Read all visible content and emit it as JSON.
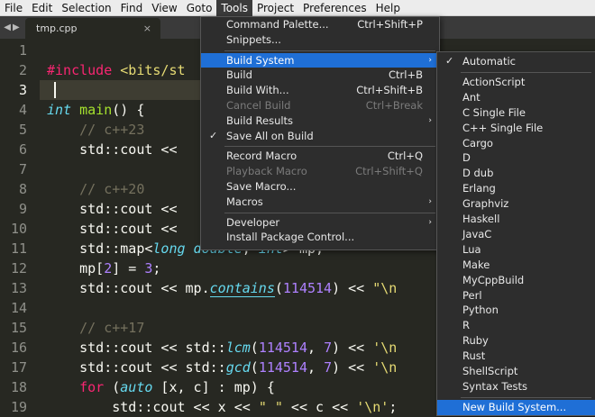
{
  "menubar": [
    "File",
    "Edit",
    "Selection",
    "Find",
    "View",
    "Goto",
    "Tools",
    "Project",
    "Preferences",
    "Help"
  ],
  "menubar_active": "Tools",
  "tabs": {
    "nav_arrows": "◀▶",
    "current": "tmp.cpp",
    "close_glyph": "×"
  },
  "editor": {
    "line_numbers": [
      "1",
      "2",
      "3",
      "4",
      "5",
      "6",
      "7",
      "8",
      "9",
      "10",
      "11",
      "12",
      "13",
      "14",
      "15",
      "16",
      "17",
      "18",
      "19"
    ],
    "current_line": "3",
    "lines": [
      [],
      [
        {
          "t": "#include ",
          "c": "pp"
        },
        {
          "t": "<bits/st",
          "c": "st"
        }
      ],
      [],
      [
        {
          "t": "int",
          "c": "tp"
        },
        {
          "t": " "
        },
        {
          "t": "main",
          "c": "fn"
        },
        {
          "t": "() {"
        }
      ],
      [
        {
          "t": "    "
        },
        {
          "t": "// c++23",
          "c": "cm"
        }
      ],
      [
        {
          "t": "    std::cout << "
        }
      ],
      [],
      [
        {
          "t": "    "
        },
        {
          "t": "// c++20",
          "c": "cm"
        }
      ],
      [
        {
          "t": "    std::cout << "
        }
      ],
      [
        {
          "t": "    std::cout << "
        }
      ],
      [
        {
          "t": "    std::map<"
        },
        {
          "t": "long double",
          "c": "tp"
        },
        {
          "t": ", "
        },
        {
          "t": "int",
          "c": "tp"
        },
        {
          "t": "> mp;"
        }
      ],
      [
        {
          "t": "    mp["
        },
        {
          "t": "2",
          "c": "nm"
        },
        {
          "t": "] = "
        },
        {
          "t": "3",
          "c": "nm"
        },
        {
          "t": ";"
        }
      ],
      [
        {
          "t": "    std::cout << mp."
        },
        {
          "t": "contains",
          "c": "tp ul"
        },
        {
          "t": "("
        },
        {
          "t": "114514",
          "c": "nm"
        },
        {
          "t": ") << "
        },
        {
          "t": "\"\\n",
          "c": "st"
        }
      ],
      [],
      [
        {
          "t": "    "
        },
        {
          "t": "// c++17",
          "c": "cm"
        }
      ],
      [
        {
          "t": "    std::cout << std::"
        },
        {
          "t": "lcm",
          "c": "tp"
        },
        {
          "t": "("
        },
        {
          "t": "114514",
          "c": "nm"
        },
        {
          "t": ", "
        },
        {
          "t": "7",
          "c": "nm"
        },
        {
          "t": ") << "
        },
        {
          "t": "'\\n",
          "c": "st"
        }
      ],
      [
        {
          "t": "    std::cout << std::"
        },
        {
          "t": "gcd",
          "c": "tp"
        },
        {
          "t": "("
        },
        {
          "t": "114514",
          "c": "nm"
        },
        {
          "t": ", "
        },
        {
          "t": "7",
          "c": "nm"
        },
        {
          "t": ") << "
        },
        {
          "t": "'\\n",
          "c": "st"
        }
      ],
      [
        {
          "t": "    "
        },
        {
          "t": "for",
          "c": "kw"
        },
        {
          "t": " ("
        },
        {
          "t": "auto",
          "c": "tp"
        },
        {
          "t": " [x, c] : mp) {"
        }
      ],
      [
        {
          "t": "        std::cout << x << "
        },
        {
          "t": "\" \"",
          "c": "st"
        },
        {
          "t": " << c << "
        },
        {
          "t": "'\\n'",
          "c": "st"
        },
        {
          "t": ";"
        }
      ]
    ]
  },
  "tools_menu": [
    {
      "label": "Command Palette...",
      "shortcut": "Ctrl+Shift+P"
    },
    {
      "label": "Snippets..."
    },
    {
      "sep": true
    },
    {
      "label": "Build System",
      "submenu": true,
      "highlighted": true
    },
    {
      "label": "Build",
      "shortcut": "Ctrl+B"
    },
    {
      "label": "Build With...",
      "shortcut": "Ctrl+Shift+B"
    },
    {
      "label": "Cancel Build",
      "shortcut": "Ctrl+Break",
      "disabled": true
    },
    {
      "label": "Build Results",
      "submenu": true
    },
    {
      "label": "Save All on Build",
      "checked": true
    },
    {
      "sep": true
    },
    {
      "label": "Record Macro",
      "shortcut": "Ctrl+Q"
    },
    {
      "label": "Playback Macro",
      "shortcut": "Ctrl+Shift+Q",
      "disabled": true
    },
    {
      "label": "Save Macro..."
    },
    {
      "label": "Macros",
      "submenu": true
    },
    {
      "sep": true
    },
    {
      "label": "Developer",
      "submenu": true
    },
    {
      "label": "Install Package Control..."
    }
  ],
  "build_system_menu": [
    {
      "label": "Automatic",
      "checked": true
    },
    {
      "sep": true
    },
    {
      "label": "ActionScript"
    },
    {
      "label": "Ant"
    },
    {
      "label": "C Single File"
    },
    {
      "label": "C++ Single File"
    },
    {
      "label": "Cargo"
    },
    {
      "label": "D"
    },
    {
      "label": "D dub"
    },
    {
      "label": "Erlang"
    },
    {
      "label": "Graphviz"
    },
    {
      "label": "Haskell"
    },
    {
      "label": "JavaC"
    },
    {
      "label": "Lua"
    },
    {
      "label": "Make"
    },
    {
      "label": "MyCppBuild"
    },
    {
      "label": "Perl"
    },
    {
      "label": "Python"
    },
    {
      "label": "R"
    },
    {
      "label": "Ruby"
    },
    {
      "label": "Rust"
    },
    {
      "label": "ShellScript"
    },
    {
      "label": "Syntax Tests"
    },
    {
      "sep": true
    },
    {
      "label": "New Build System...",
      "highlighted": true
    }
  ],
  "glyphs": {
    "check": "✓",
    "submenu_arrow": "›"
  },
  "colors": {
    "editor_bg": "#272822",
    "menu_bg": "#2d2d2d",
    "highlight": "#1f6fd6"
  }
}
